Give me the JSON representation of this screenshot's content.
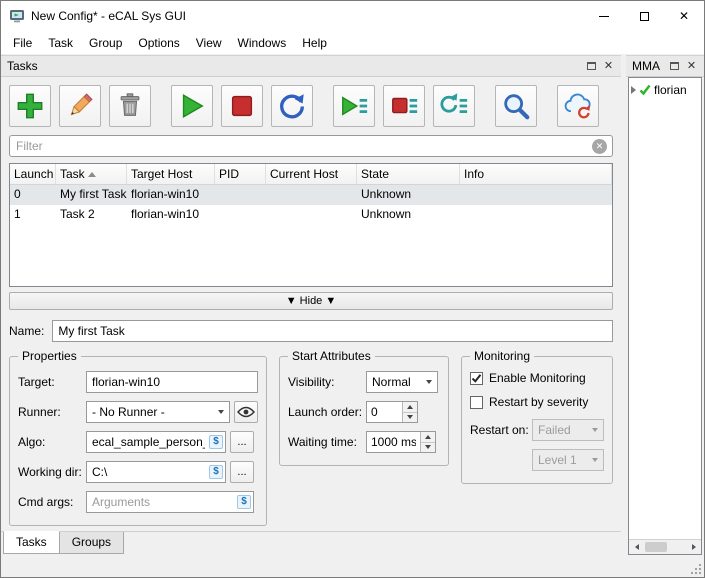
{
  "window": {
    "title": "New Config* - eCAL Sys GUI"
  },
  "icons": {
    "close": "✕",
    "clear": "✕",
    "env_var": "$"
  },
  "menubar": {
    "items": [
      "File",
      "Task",
      "Group",
      "Options",
      "View",
      "Windows",
      "Help"
    ]
  },
  "tasks_dock": {
    "title": "Tasks",
    "toolbar": {
      "buttons": [
        "add-task",
        "edit-task",
        "delete-task",
        "start-task",
        "stop-task",
        "restart-task",
        "start-all-tasks",
        "stop-all-tasks",
        "restart-all-tasks",
        "find-tasks",
        "update-from-cloud"
      ]
    },
    "filter": {
      "placeholder": "Filter"
    },
    "table": {
      "columns": [
        "Launch",
        "Task",
        "Target Host",
        "PID",
        "Current Host",
        "State",
        "Info"
      ],
      "sort_column": "Task",
      "rows": [
        {
          "launch": "0",
          "task": "My first Task",
          "target_host": "florian-win10",
          "pid": "",
          "current_host": "",
          "state": "Unknown",
          "info": "",
          "selected": true
        },
        {
          "launch": "1",
          "task": "Task 2",
          "target_host": "florian-win10",
          "pid": "",
          "current_host": "",
          "state": "Unknown",
          "info": "",
          "selected": false
        }
      ]
    },
    "hide_button": "▼ Hide ▼",
    "editor": {
      "name_label": "Name:",
      "name_value": "My first Task",
      "properties": {
        "title": "Properties",
        "target_label": "Target:",
        "target_value": "florian-win10",
        "runner_label": "Runner:",
        "runner_value": "- No Runner -",
        "algo_label": "Algo:",
        "algo_value": "ecal_sample_person_snd",
        "working_dir_label": "Working dir:",
        "working_dir_value": "C:\\",
        "cmd_args_label": "Cmd args:",
        "cmd_args_placeholder": "Arguments",
        "browse_label": "..."
      },
      "start_attributes": {
        "title": "Start Attributes",
        "visibility_label": "Visibility:",
        "visibility_value": "Normal",
        "launch_order_label": "Launch order:",
        "launch_order_value": "0",
        "waiting_time_label": "Waiting time:",
        "waiting_time_value": "1000 ms"
      },
      "monitoring": {
        "title": "Monitoring",
        "enable_monitoring_label": "Enable Monitoring",
        "enable_monitoring_checked": true,
        "restart_by_severity_label": "Restart by severity",
        "restart_by_severity_checked": false,
        "restart_on_label": "Restart on:",
        "restart_on_value": "Failed",
        "severity_level_value": "Level 1"
      }
    },
    "tabs": [
      {
        "label": "Tasks",
        "active": true
      },
      {
        "label": "Groups",
        "active": false
      }
    ]
  },
  "mma_dock": {
    "title": "MMA",
    "tree": [
      {
        "label": "florian",
        "status": "ok"
      }
    ]
  }
}
